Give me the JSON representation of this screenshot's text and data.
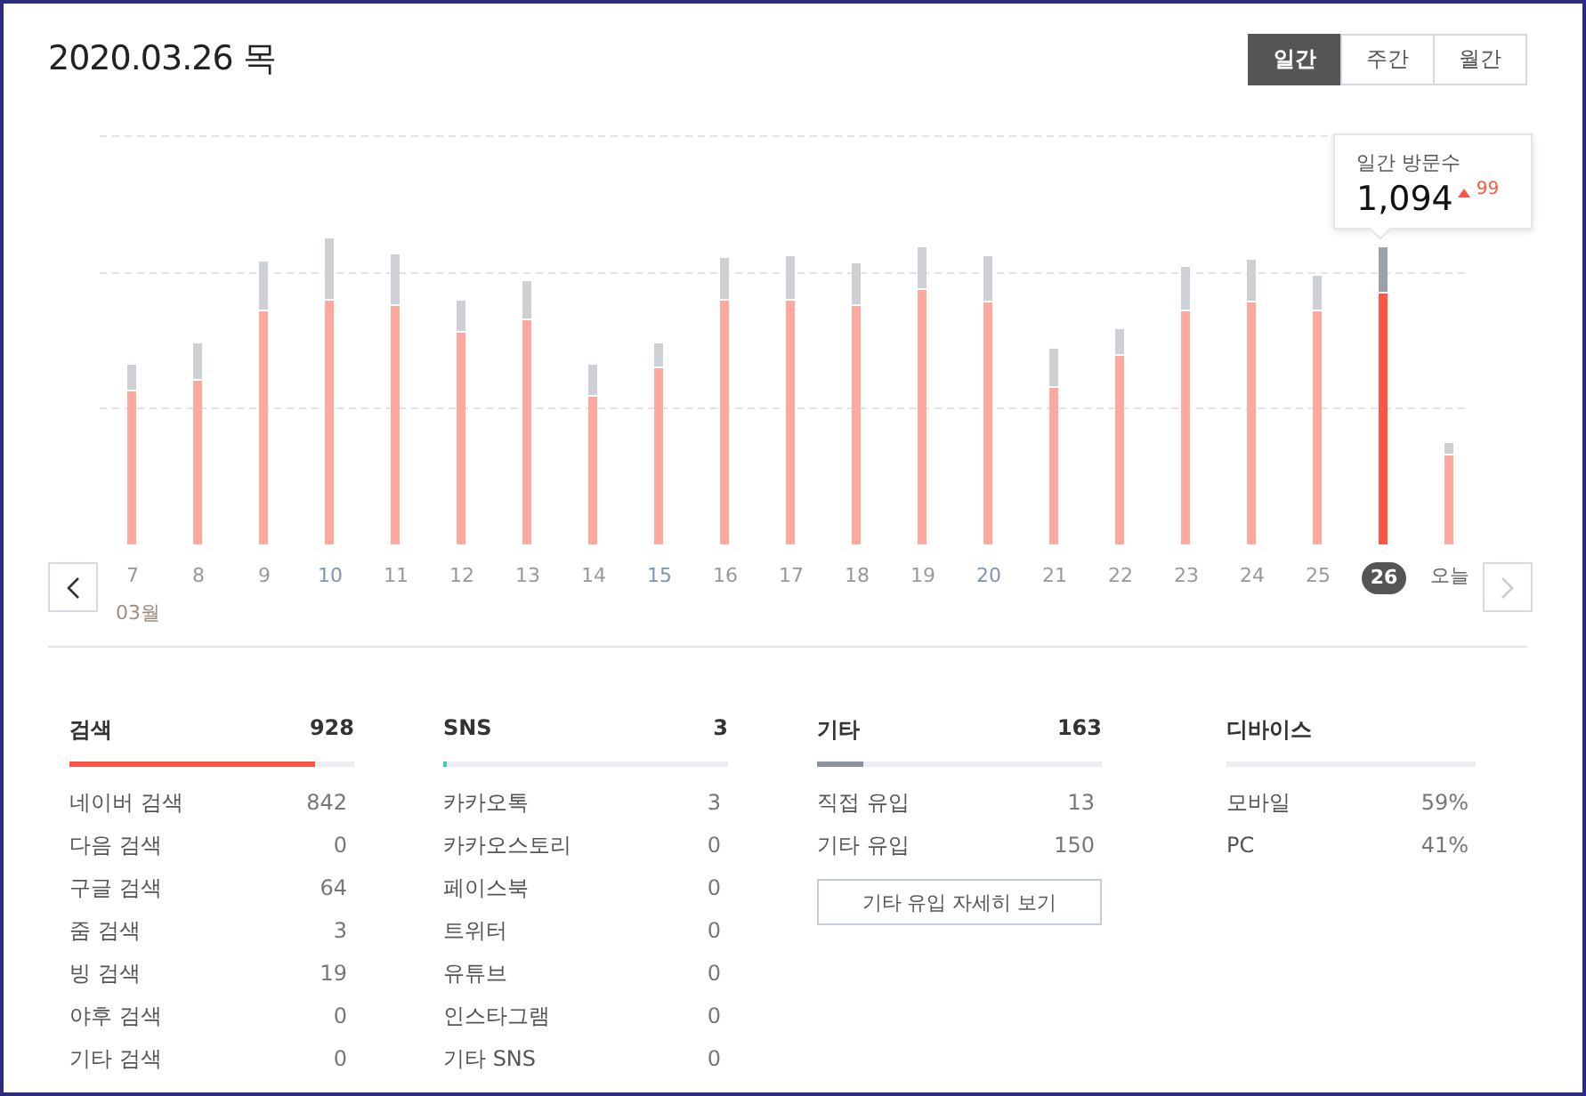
{
  "date_title": "2020.03.26 목",
  "period_tabs": [
    {
      "label": "일간",
      "selected": true
    },
    {
      "label": "주간",
      "selected": false
    },
    {
      "label": "월간",
      "selected": false
    }
  ],
  "chart": {
    "days": [
      {
        "label": "7",
        "selected": false,
        "color": "#999999"
      },
      {
        "label": "8",
        "selected": false,
        "color": "#999999"
      },
      {
        "label": "9",
        "selected": false,
        "color": "#999999"
      },
      {
        "label": "10",
        "selected": false,
        "color": "#7f93b3"
      },
      {
        "label": "11",
        "selected": false,
        "color": "#999999"
      },
      {
        "label": "12",
        "selected": false,
        "color": "#999999"
      },
      {
        "label": "13",
        "selected": false,
        "color": "#999999"
      },
      {
        "label": "14",
        "selected": false,
        "color": "#999999"
      },
      {
        "label": "15",
        "selected": false,
        "color": "#7f93b3"
      },
      {
        "label": "16",
        "selected": false,
        "color": "#999999"
      },
      {
        "label": "17",
        "selected": false,
        "color": "#999999"
      },
      {
        "label": "18",
        "selected": false,
        "color": "#999999"
      },
      {
        "label": "19",
        "selected": false,
        "color": "#999999"
      },
      {
        "label": "20",
        "selected": false,
        "color": "#7f93b3"
      },
      {
        "label": "21",
        "selected": false,
        "color": "#999999"
      },
      {
        "label": "22",
        "selected": false,
        "color": "#999999"
      },
      {
        "label": "23",
        "selected": false,
        "color": "#999999"
      },
      {
        "label": "24",
        "selected": false,
        "color": "#999999"
      },
      {
        "label": "25",
        "selected": false,
        "color": "#999999"
      },
      {
        "label": "26",
        "selected": true
      },
      {
        "label": "오늘",
        "selected": false,
        "color": "#666666"
      }
    ],
    "month_label": "03월",
    "tooltip": {
      "title": "일간 방문수",
      "value": "1,094",
      "change": "99"
    }
  },
  "sections": [
    {
      "title": "검색",
      "total": "928",
      "level": 0.86,
      "color": "#ff5544",
      "rows": [
        {
          "label": "네이버 검색",
          "value": "842"
        },
        {
          "label": "다음 검색",
          "value": "0"
        },
        {
          "label": "구글 검색",
          "value": "64"
        },
        {
          "label": "줌 검색",
          "value": "3"
        },
        {
          "label": "빙 검색",
          "value": "19"
        },
        {
          "label": "야후 검색",
          "value": "0"
        },
        {
          "label": "기타 검색",
          "value": "0"
        }
      ]
    },
    {
      "title": "SNS",
      "total": "3",
      "level": 0.01,
      "color": "#33cccc",
      "rows": [
        {
          "label": "카카오톡",
          "value": "3"
        },
        {
          "label": "카카오스토리",
          "value": "0"
        },
        {
          "label": "페이스북",
          "value": "0"
        },
        {
          "label": "트위터",
          "value": "0"
        },
        {
          "label": "유튜브",
          "value": "0"
        },
        {
          "label": "인스타그램",
          "value": "0"
        },
        {
          "label": "기타 SNS",
          "value": "0"
        }
      ]
    },
    {
      "title": "기타",
      "total": "163",
      "level": 0.16,
      "color": "#8a929c",
      "rows": [
        {
          "label": "직접 유입",
          "value": "13"
        },
        {
          "label": "기타 유입",
          "value": "150"
        }
      ],
      "button": "기타 유입 자세히 보기"
    },
    {
      "title": "디바이스",
      "rows": [
        {
          "label": "모바일",
          "value": "59%"
        },
        {
          "label": "PC",
          "value": "41%"
        }
      ]
    }
  ]
}
